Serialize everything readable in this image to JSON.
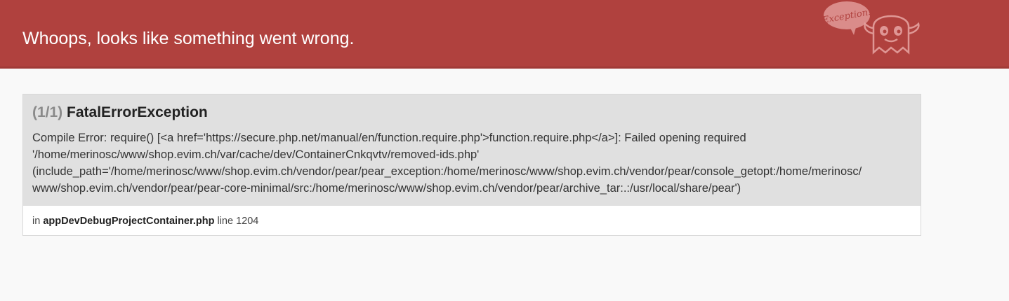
{
  "header": {
    "title": "Whoops, looks like something went wrong.",
    "logo_bubble_text": "Exception!"
  },
  "exception": {
    "counter": "(1/1)",
    "class_name": "FatalErrorException",
    "message_lines": [
      "Compile Error: require() [<a href='https://secure.php.net/manual/en/function.require.php'>function.require.php</a>]: Failed opening required",
      "'/home/merinosc/www/shop.evim.ch/var/cache/dev/ContainerCnkqvtv/removed-ids.php'",
      "(include_path='/home/merinosc/www/shop.evim.ch/vendor/pear/pear_exception:/home/merinosc/www/shop.evim.ch/vendor/pear/console_getopt:/home/merinosc/",
      "www/shop.evim.ch/vendor/pear/pear-core-minimal/src:/home/merinosc/www/shop.evim.ch/vendor/pear/archive_tar:.:/usr/local/share/pear')"
    ],
    "location": {
      "prefix": "in",
      "file": "appDevDebugProjectContainer.php",
      "line_label": "line 1204"
    }
  },
  "colors": {
    "header_bg": "#b0413e",
    "page_bg": "#f9f9f9",
    "exception_head_bg": "#e0e0e0"
  }
}
